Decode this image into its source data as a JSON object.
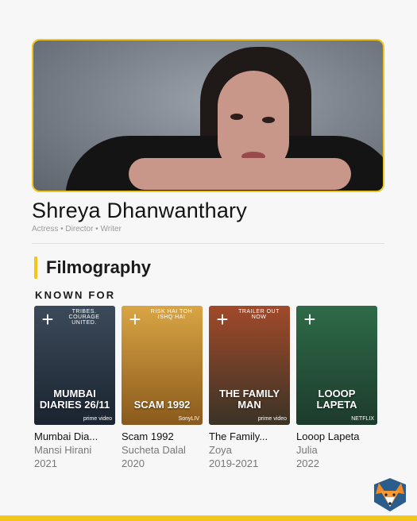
{
  "profile": {
    "name": "Shreya Dhanwanthary",
    "roles": "Actress • Director • Writer"
  },
  "section": {
    "title": "Filmography",
    "subtitle": "KNOWN FOR"
  },
  "films": [
    {
      "title": "Mumbai Dia...",
      "role": "Mansi Hirani",
      "year": "2021",
      "poster_title": "MUMBAI DIARIES 26/11",
      "poster_tag": "TRIBES. COURAGE UNITED.",
      "poster_brand": "prime video",
      "poster_color_top": "#3b4a5a",
      "poster_color_bottom": "#1b2430"
    },
    {
      "title": "Scam 1992",
      "role": "Sucheta Dalal",
      "year": "2020",
      "poster_title": "SCAM 1992",
      "poster_tag": "RISK HAI TOH ISHQ HAI",
      "poster_brand": "SonyLIV",
      "poster_color_top": "#d9a544",
      "poster_color_bottom": "#8a5a1c"
    },
    {
      "title": "The Family...",
      "role": "Zoya",
      "year": "2019-2021",
      "poster_title": "THE FAMILY MAN",
      "poster_tag": "TRAILER OUT NOW",
      "poster_brand": "prime video",
      "poster_color_top": "#a14a2a",
      "poster_color_bottom": "#3a3326"
    },
    {
      "title": "Looop Lapeta",
      "role": "Julia",
      "year": "2022",
      "poster_title": "LOOOP LAPETA",
      "poster_tag": "",
      "poster_brand": "NETFLIX",
      "poster_color_top": "#2e6b48",
      "poster_color_bottom": "#1d3b2c"
    }
  ],
  "accent_color": "#f5c518",
  "icons": {
    "add": "+",
    "logo": "fox-logo"
  }
}
